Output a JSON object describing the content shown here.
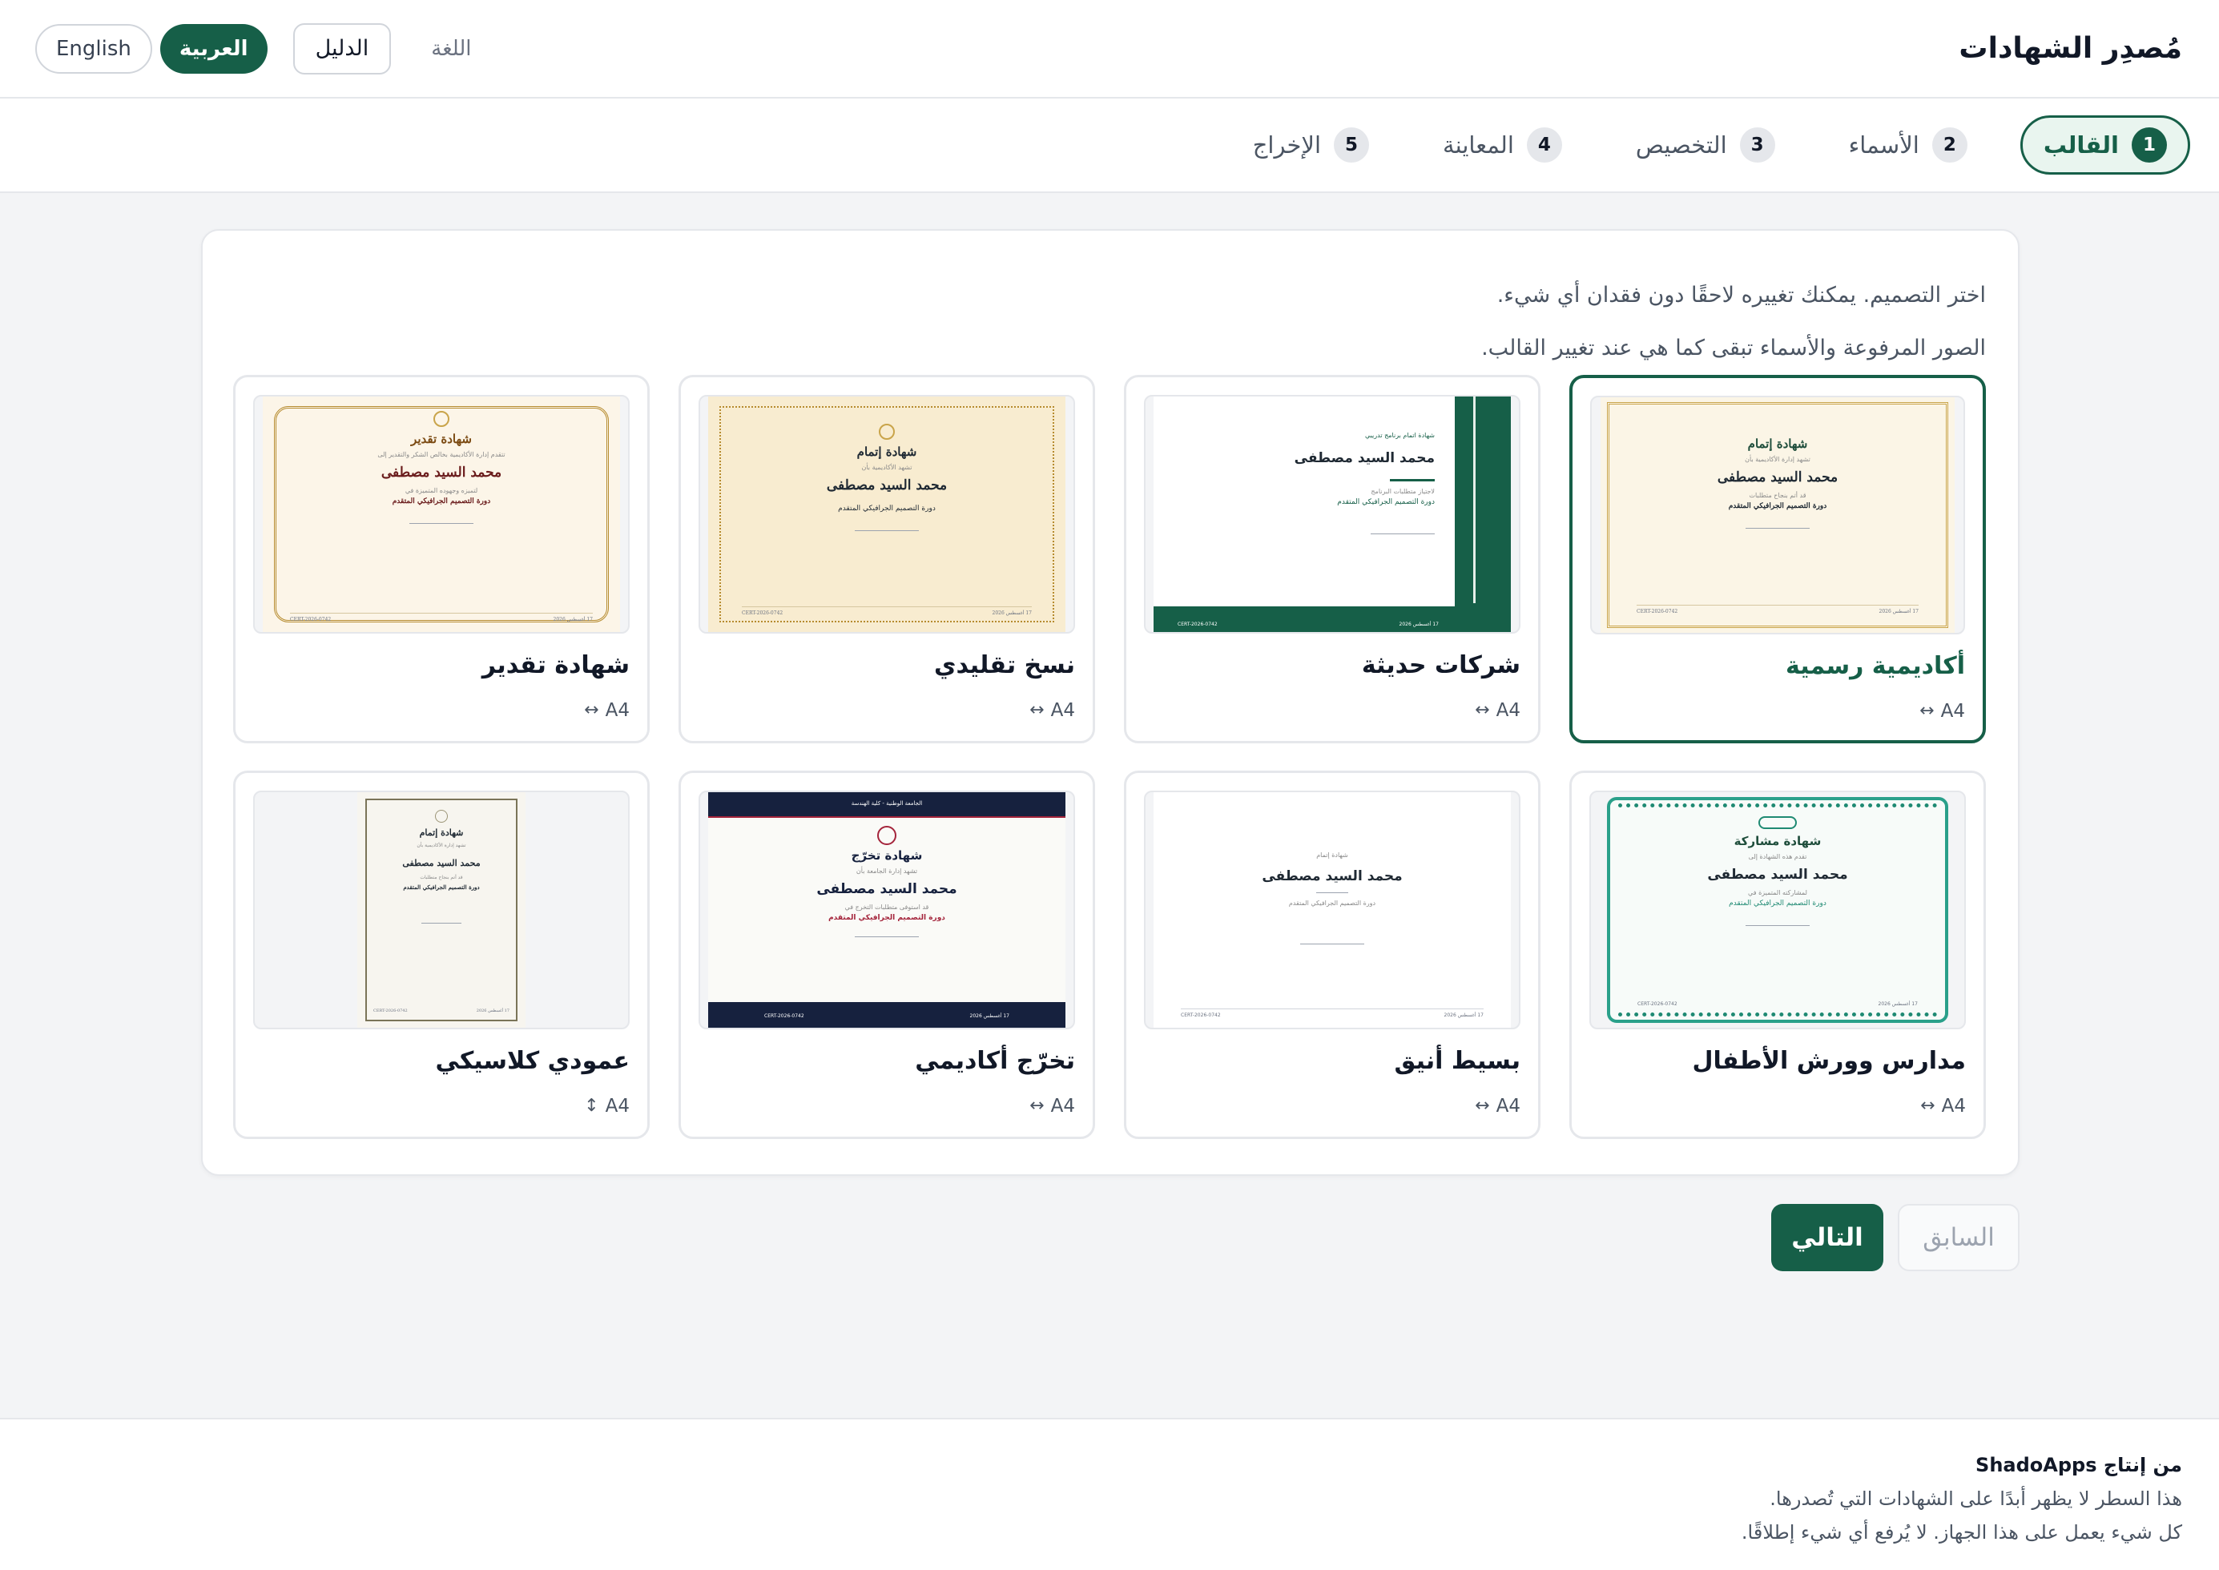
{
  "header": {
    "app_title": "مُصدِر الشهادات",
    "language_label": "اللغة",
    "guide_button": "الدليل",
    "languages": [
      {
        "label": "العربية",
        "active": true
      },
      {
        "label": "English",
        "active": false
      }
    ]
  },
  "steps": [
    {
      "num": "1",
      "label": "القالب",
      "active": true
    },
    {
      "num": "2",
      "label": "الأسماء",
      "active": false
    },
    {
      "num": "3",
      "label": "التخصيص",
      "active": false
    },
    {
      "num": "4",
      "label": "المعاينة",
      "active": false
    },
    {
      "num": "5",
      "label": "الإخراج",
      "active": false
    }
  ],
  "intro": {
    "line1": "اختر التصميم. يمكنك تغييره لاحقًا دون فقدان أي شيء.",
    "line2": "الصور المرفوعة والأسماء تبقى كما هي عند تغيير القالب."
  },
  "templates": [
    {
      "name": "أكاديمية رسمية",
      "size": "A4",
      "orientation_icon": "↔",
      "selected": true,
      "preview": {
        "title": "شهادة إتمام",
        "subtitle": "تشهد إدارة الأكاديمية بأن",
        "name": "محمد السيد مصطفى",
        "text": "قد أتم بنجاح متطلبات",
        "course": "دورة التصميم الجرافيكي المتقدم",
        "date": "17 أغسطس 2026",
        "serial": "CERT-2026-0742"
      }
    },
    {
      "name": "شركات حديثة",
      "size": "A4",
      "orientation_icon": "↔",
      "selected": false,
      "preview": {
        "title": "شهادة اتمام برنامج تدريبي",
        "name": "محمد السيد مصطفى",
        "text": "لاجتياز متطلبات البرنامج",
        "course": "دورة التصميم الجرافيكي المتقدم",
        "date": "17 أغسطس 2026",
        "serial": "CERT-2026-0742"
      }
    },
    {
      "name": "نسخ تقليدي",
      "size": "A4",
      "orientation_icon": "↔",
      "selected": false,
      "preview": {
        "title": "شهادة إتمام",
        "subtitle": "تشهد الأكاديمية بأن",
        "name": "محمد السيد مصطفى",
        "course": "دورة التصميم الجرافيكي المتقدم",
        "date": "17 أغسطس 2026",
        "serial": "CERT-2026-0742"
      }
    },
    {
      "name": "شهادة تقدير",
      "size": "A4",
      "orientation_icon": "↔",
      "selected": false,
      "preview": {
        "title": "شهادة تقدير",
        "subtitle": "تتقدم إدارة الأكاديمية بخالص الشكر والتقدير إلى",
        "name": "محمد السيد مصطفى",
        "text": "لتميزه وجهوده المتميزة في",
        "course": "دورة التصميم الجرافيكي المتقدم",
        "date": "17 أغسطس 2026",
        "serial": "CERT-2026-0742"
      }
    },
    {
      "name": "مدارس وورش الأطفال",
      "size": "A4",
      "orientation_icon": "↔",
      "selected": false,
      "preview": {
        "title": "شهادة مشاركة",
        "subtitle": "تقدم هذه الشهادة إلى",
        "name": "محمد السيد مصطفى",
        "text": "لمشاركته المتميزة في",
        "course": "دورة التصميم الجرافيكي المتقدم",
        "date": "17 أغسطس 2026",
        "serial": "CERT-2026-0742"
      }
    },
    {
      "name": "بسيط أنيق",
      "size": "A4",
      "orientation_icon": "↔",
      "selected": false,
      "preview": {
        "title": "شهادة إتمام",
        "name": "محمد السيد مصطفى",
        "course": "دورة التصميم الجرافيكي المتقدم",
        "date": "17 أغسطس 2026",
        "serial": "CERT-2026-0742"
      }
    },
    {
      "name": "تخرّج أكاديمي",
      "size": "A4",
      "orientation_icon": "↔",
      "selected": false,
      "preview": {
        "header": "الجامعة الوطنية - كلية الهندسة",
        "title": "شهادة تخرّج",
        "subtitle": "تشهد إدارة الجامعة بأن",
        "name": "محمد السيد مصطفى",
        "text": "قد استوفى متطلبات التخرج في",
        "course": "دورة التصميم الجرافيكي المتقدم",
        "date": "17 أغسطس 2026",
        "serial": "CERT-2026-0742"
      }
    },
    {
      "name": "عمودي كلاسيكي",
      "size": "A4",
      "orientation_icon": "↕",
      "selected": false,
      "preview": {
        "title": "شهادة إتمام",
        "subtitle": "تشهد إدارة الأكاديمية بأن",
        "name": "محمد السيد مصطفى",
        "text": "قد أتم بنجاح متطلبات",
        "course": "دورة التصميم الجرافيكي المتقدم",
        "date": "17 أغسطس 2026",
        "serial": "CERT-2026-0742"
      }
    }
  ],
  "nav": {
    "next": "التالي",
    "previous": "السابق"
  },
  "footer": {
    "brand": "من إنتاج ShadoApps",
    "line1": "هذا السطر لا يظهر أبدًا على الشهادات التي تُصدرها.",
    "line2": "كل شيء يعمل على هذا الجهاز. لا يُرفع أي شيء إطلاقًا."
  },
  "colors": {
    "accent": "#165f48",
    "gold": "#c9a44a",
    "navy": "#16213e"
  }
}
